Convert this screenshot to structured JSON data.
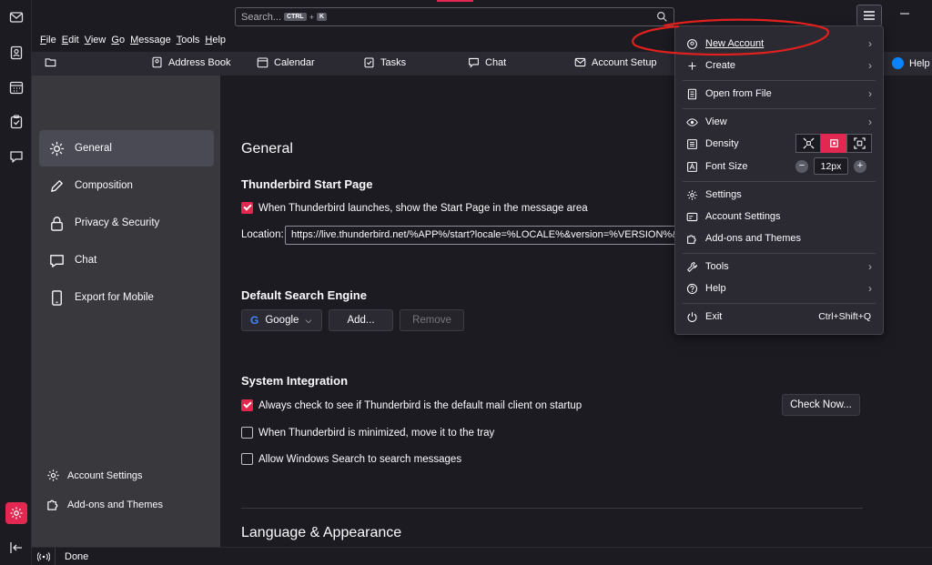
{
  "titlebar": {
    "search_placeholder": "Search...",
    "kbd_ctrl": "CTRL",
    "kbd_plus": "+",
    "kbd_k": "K"
  },
  "menubar": [
    "File",
    "Edit",
    "View",
    "Go",
    "Message",
    "Tools",
    "Help"
  ],
  "toolbar": {
    "address_book": "Address Book",
    "calendar": "Calendar",
    "tasks": "Tasks",
    "chat": "Chat",
    "account_setup": "Account Setup",
    "help": "Help"
  },
  "leftnav": {
    "categories": [
      {
        "label": "General",
        "icon": "gear-icon",
        "selected": true
      },
      {
        "label": "Composition",
        "icon": "pencil-icon"
      },
      {
        "label": "Privacy & Security",
        "icon": "lock-icon"
      },
      {
        "label": "Chat",
        "icon": "chat-icon"
      },
      {
        "label": "Export for Mobile",
        "icon": "mobile-icon"
      }
    ],
    "footer": {
      "account_settings": "Account Settings",
      "addons": "Add-ons and Themes"
    }
  },
  "content": {
    "page_title": "General",
    "start_page": {
      "heading": "Thunderbird Start Page",
      "checkbox_label": "When Thunderbird launches, show the Start Page in the message area",
      "checked": true,
      "location_label": "Location:",
      "location_value": "https://live.thunderbird.net/%APP%/start?locale=%LOCALE%&version=%VERSION%&"
    },
    "search_engine": {
      "heading": "Default Search Engine",
      "engine": "Google",
      "add": "Add...",
      "remove": "Remove"
    },
    "system_integration": {
      "heading": "System Integration",
      "default_check": "Always check to see if Thunderbird is the default mail client on startup",
      "check_now": "Check Now...",
      "minimize_tray": "When Thunderbird is minimized, move it to the tray",
      "windows_search": "Allow Windows Search to search messages"
    },
    "language_heading": "Language & Appearance"
  },
  "status": {
    "text": "Done"
  },
  "appmenu": {
    "new_account": "New Account",
    "create": "Create",
    "open_from_file": "Open from File",
    "view": "View",
    "density": "Density",
    "font_size": "Font Size",
    "font_size_value": "12px",
    "font_minus": "−",
    "font_plus": "+",
    "settings": "Settings",
    "account_settings": "Account Settings",
    "addons": "Add-ons and Themes",
    "tools": "Tools",
    "help": "Help",
    "exit": "Exit",
    "exit_shortcut": "Ctrl+Shift+Q"
  },
  "colors": {
    "accent": "#e22850",
    "background": "#1c1b22",
    "panel": "#2b2a33",
    "annotation_red": "#e0201c"
  }
}
